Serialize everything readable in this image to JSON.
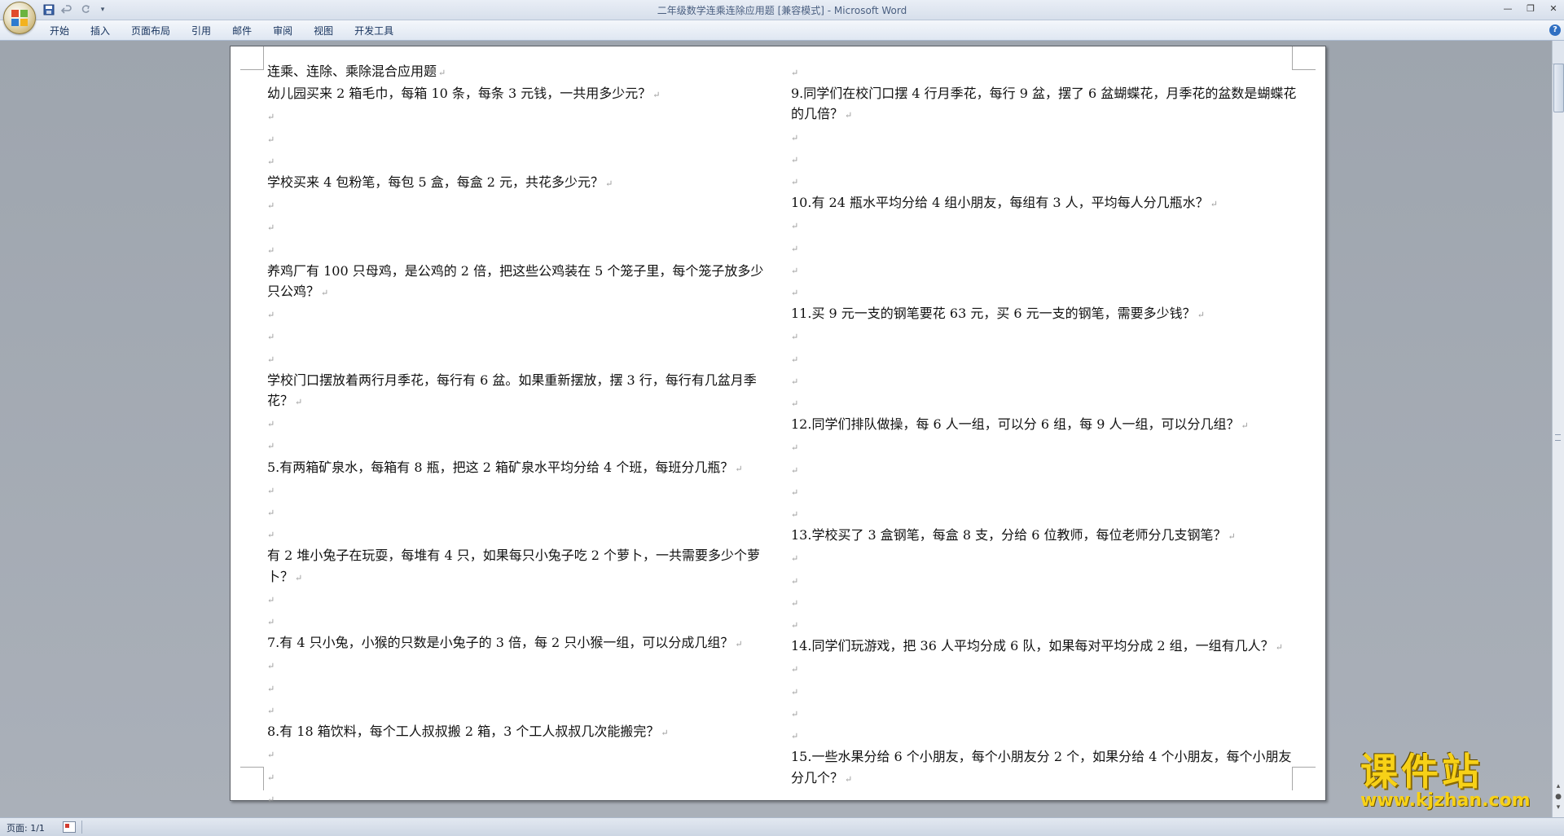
{
  "window": {
    "title": "二年级数学连乘连除应用题 [兼容模式] - Microsoft Word"
  },
  "ribbon": {
    "tabs": [
      "开始",
      "插入",
      "页面布局",
      "引用",
      "邮件",
      "审阅",
      "视图",
      "开发工具"
    ]
  },
  "document": {
    "left_column": [
      "连乘、连除、乘除混合应用题",
      "幼儿园买来 2 箱毛巾，每箱 10 条，每条 3 元钱，一共用多少元？",
      "",
      "",
      "",
      " 学校买来 4 包粉笔，每包 5 盒，每盒 2 元，共花多少元？",
      "",
      "",
      "",
      "养鸡厂有 100 只母鸡，是公鸡的 2 倍，把这些公鸡装在 5 个笼子里，每个笼子放多少只公鸡？",
      "",
      "",
      "",
      "学校门口摆放着两行月季花，每行有 6 盆。如果重新摆放，摆 3 行，每行有几盆月季花？",
      "",
      "",
      "5.有两箱矿泉水，每箱有 8 瓶，把这 2 箱矿泉水平均分给 4 个班，每班分几瓶？",
      "",
      "",
      "",
      "有 2 堆小兔子在玩耍，每堆有 4 只，如果每只小兔子吃 2 个萝卜，一共需要多少个萝卜？",
      "",
      "",
      "7.有 4 只小兔，小猴的只数是小兔子的 3 倍，每 2 只小猴一组，可以分成几组？",
      "",
      "",
      "",
      "8.有 18 箱饮料，每个工人叔叔搬 2 箱，3 个工人叔叔几次能搬完？",
      "",
      "",
      ""
    ],
    "right_column": [
      "",
      "9.同学们在校门口摆 4 行月季花，每行 9 盆，摆了 6 盆蝴蝶花，月季花的盆数是蝴蝶花的几倍？",
      "",
      "",
      "",
      "10.有 24 瓶水平均分给 4 组小朋友，每组有 3 人，平均每人分几瓶水？",
      "",
      "",
      "",
      "",
      "11.买 9 元一支的钢笔要花 63 元，买 6 元一支的钢笔，需要多少钱？",
      "",
      "",
      "",
      "",
      "12.同学们排队做操，每 6 人一组，可以分 6 组，每 9 人一组，可以分几组？",
      "",
      "",
      "",
      "",
      "13.学校买了 3 盒钢笔，每盒 8 支，分给 6 位教师，每位老师分几支钢笔？",
      "",
      "",
      "",
      "",
      "14.同学们玩游戏，把 36 人平均分成 6 队，如果每对平均分成 2 组，一组有几人？",
      "",
      "",
      "",
      "",
      "15.一些水果分给 6 个小朋友，每个小朋友分 2 个，如果分给 4 个小朋友，每个小朋友分几个？"
    ],
    "paragraph_mark": "↵"
  },
  "statusbar": {
    "page_info": "页面: 1/1"
  },
  "watermark": {
    "top": "课件站",
    "bottom": "www.kjzhan.com"
  }
}
